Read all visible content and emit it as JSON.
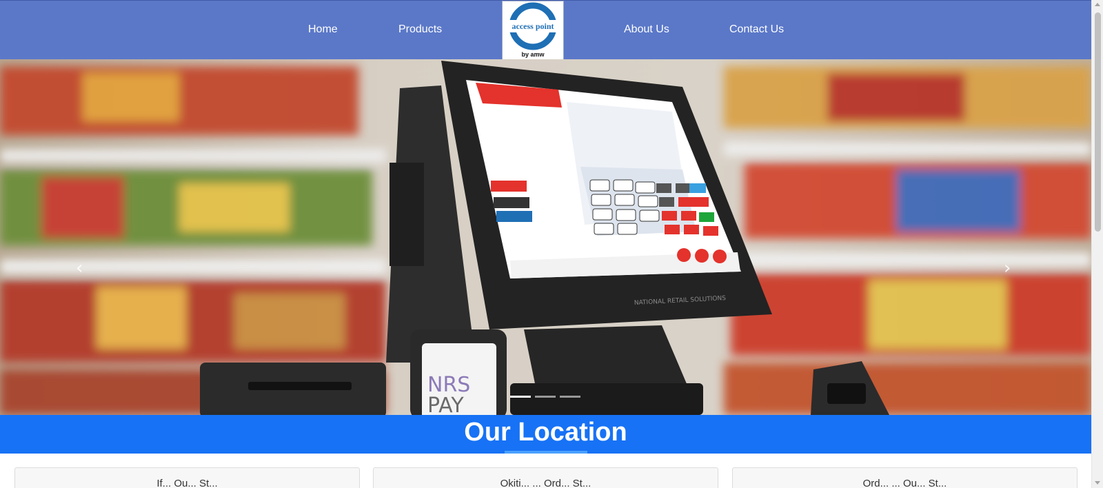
{
  "nav": {
    "home": "Home",
    "products": "Products",
    "about": "About Us",
    "contact": "Contact Us"
  },
  "logo": {
    "text": "access point",
    "sub": "by amw"
  },
  "hero": {
    "prev_glyph": "‹",
    "next_glyph": "›",
    "slide_count": 3,
    "active_slide": 1,
    "device_brand": "NRS",
    "device_brand2": "PAY",
    "monitor_brand": "NATIONAL RETAIL SOLUTIONS"
  },
  "location": {
    "title": "Our Location"
  },
  "cards": [
    {
      "title": "If... Ou... St..."
    },
    {
      "title": "Okiti... ... Ord... St..."
    },
    {
      "title": "Ord... ... Ou... St..."
    }
  ],
  "colors": {
    "navbar": "#5b78c8",
    "banner": "#1772f5",
    "logo_ring": "#1f6fb5"
  }
}
